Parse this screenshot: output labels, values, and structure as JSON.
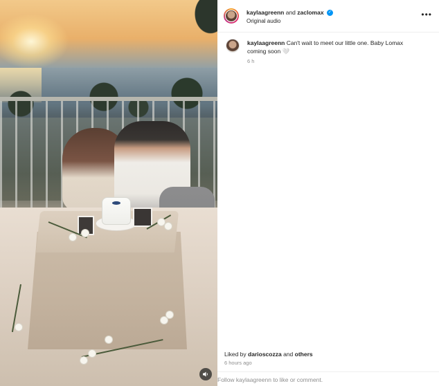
{
  "post": {
    "usernames": {
      "primary": "kaylaagreenn",
      "conjunction": "and",
      "secondary": "zaclomax"
    },
    "audio_label": "Original audio",
    "more_icon": "more-horizontal-icon"
  },
  "caption": {
    "username": "kaylaagreenn",
    "text": "Can't wait to meet our little one. Baby Lomax coming soon",
    "emoji": "🤍",
    "time": "6 h"
  },
  "engagement": {
    "liked_by_prefix": "Liked by",
    "liked_by_user": "darioscozza",
    "and_text": "and",
    "others": "others",
    "post_age": "6 hours ago"
  },
  "footer": {
    "follow_prompt": "Follow kaylaagreenn to like or comment."
  },
  "colors": {
    "verified_badge": "#0095f6",
    "muted_text": "#8e8e8e",
    "primary_text": "#262626"
  }
}
